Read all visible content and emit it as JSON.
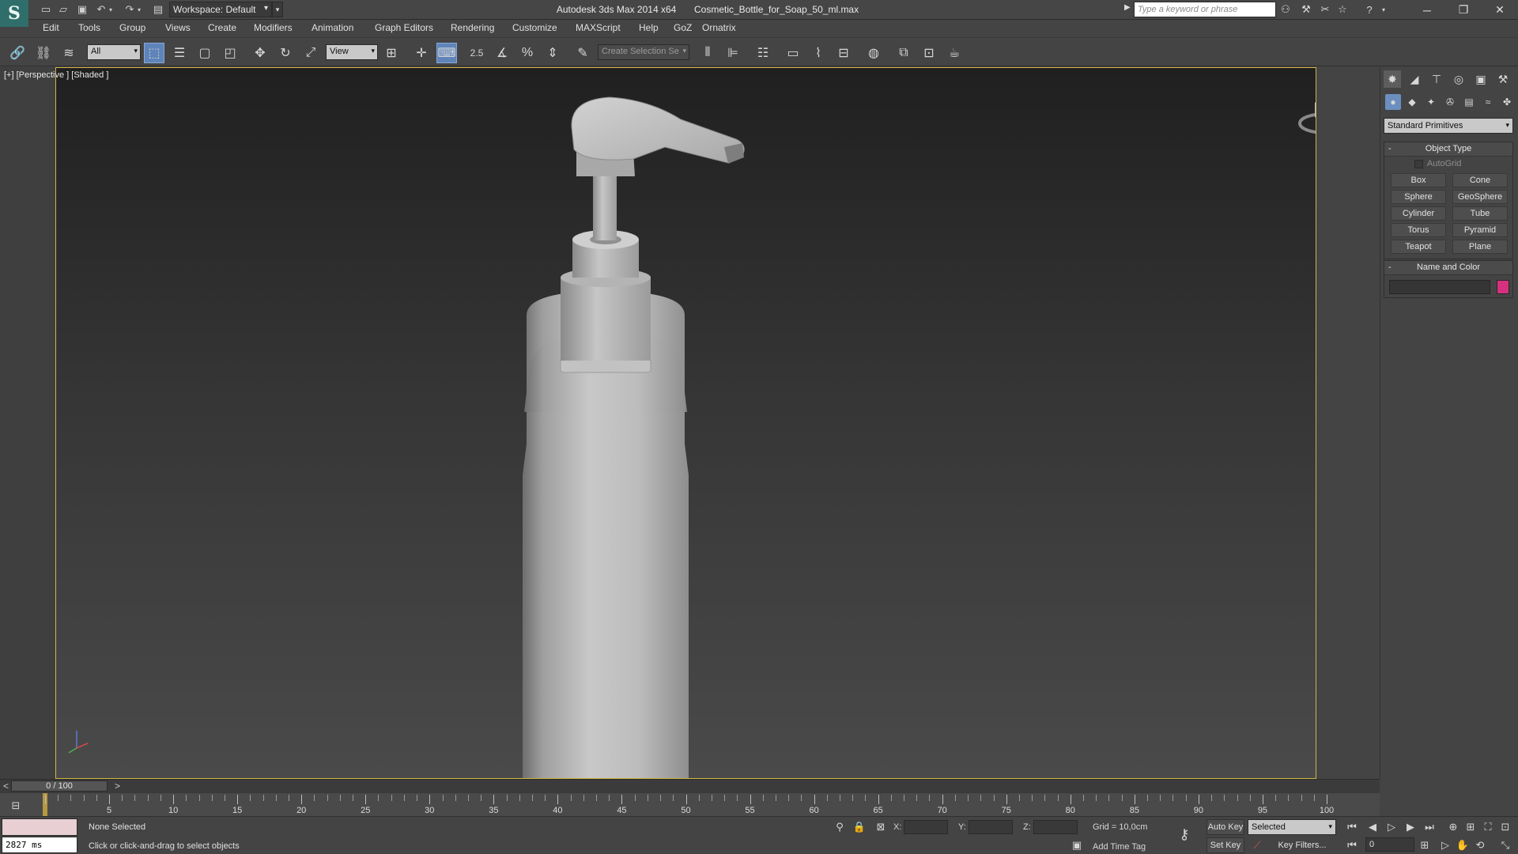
{
  "window": {
    "app_title": "Autodesk 3ds Max  2014 x64",
    "file_name": "Cosmetic_Bottle_for_Soap_50_ml.max",
    "workspace_label": "Workspace: Default",
    "search_placeholder": "Type a keyword or phrase"
  },
  "menu": [
    "Edit",
    "Tools",
    "Group",
    "Views",
    "Create",
    "Modifiers",
    "Animation",
    "Graph Editors",
    "Rendering",
    "Customize",
    "MAXScript",
    "Help",
    "GoZ",
    "Ornatrix"
  ],
  "toolbar": {
    "filter_value": "All",
    "ref_coord_value": "View",
    "snap_value": "2.5",
    "named_selection_placeholder": "Create Selection Se"
  },
  "viewport": {
    "label": "[+] [Perspective ] [Shaded ]"
  },
  "command_panel": {
    "category": "Standard Primitives",
    "object_type_title": "Object Type",
    "autogrid_label": "AutoGrid",
    "buttons": [
      "Box",
      "Cone",
      "Sphere",
      "GeoSphere",
      "Cylinder",
      "Tube",
      "Torus",
      "Pyramid",
      "Teapot",
      "Plane"
    ],
    "name_color_title": "Name and Color",
    "object_color": "#d6317e"
  },
  "timeline": {
    "slider_label": "0 / 100",
    "prev_arrow": "<",
    "next_arrow": ">",
    "numbers": [
      "5",
      "10",
      "15",
      "20",
      "25",
      "30",
      "35",
      "40",
      "45",
      "50",
      "55",
      "60",
      "65",
      "70",
      "75",
      "80",
      "85",
      "90",
      "95",
      "100"
    ]
  },
  "status": {
    "selection": "None Selected",
    "prompt": "Click or click-and-drag to select objects",
    "render_time": "2827 ms",
    "x_label": "X:",
    "y_label": "Y:",
    "z_label": "Z:",
    "grid": "Grid = 10,0cm",
    "add_time_tag": "Add Time Tag",
    "auto_key": "Auto Key",
    "set_key": "Set Key",
    "key_mode": "Selected",
    "key_filters": "Key Filters...",
    "frame": "0"
  },
  "colors": {
    "viewport_border": "#d2b446",
    "active_tool": "#5f84b9"
  }
}
